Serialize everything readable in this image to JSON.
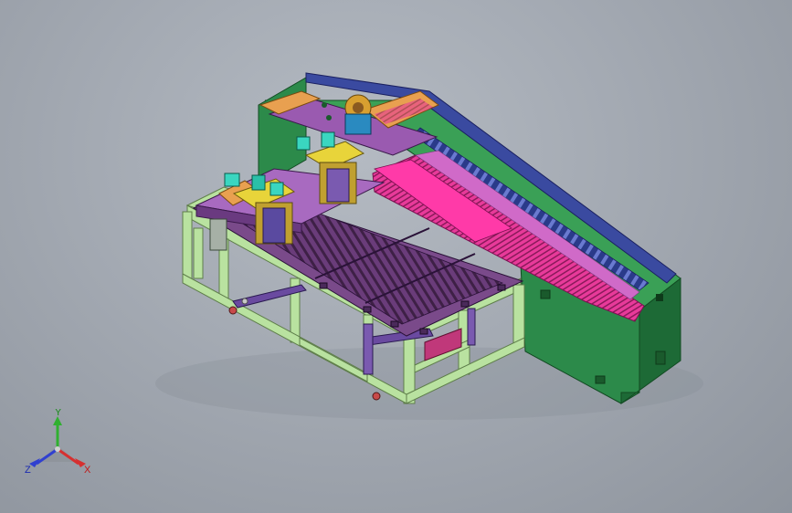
{
  "viewport": {
    "background_top": "#b4bac2",
    "background_bottom": "#8e949d"
  },
  "model": {
    "colors": {
      "frame": "#b9e2a0",
      "frame_edge": "#5e7d4a",
      "base_green": "#2c8a4a",
      "base_dark": "#1d6a36",
      "bed_purple": "#7a4a8a",
      "slat": "#5a3268",
      "pink_cover": "#e83a9a",
      "rail_purple": "#9a5ab0",
      "rail_blue": "#3a4aa0",
      "head_yellow": "#e8d43a",
      "head_cyan": "#3ad6c0",
      "orange": "#e8a050",
      "brown": "#7a5a30"
    }
  },
  "triad": {
    "x_label": "X",
    "y_label": "Y",
    "z_label": "Z",
    "x_color": "#d63030",
    "y_color": "#30b030",
    "z_color": "#3040d0"
  }
}
